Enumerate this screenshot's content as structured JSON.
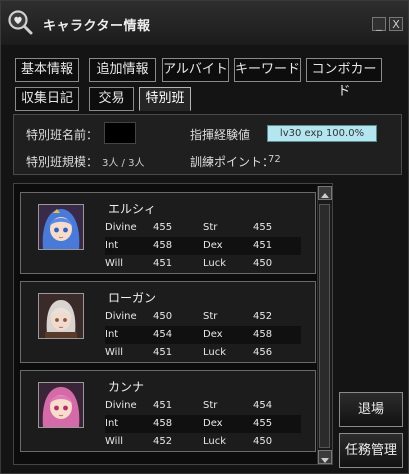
{
  "window": {
    "title": "キャラクター情報",
    "minimize_label": "_",
    "close_label": "X"
  },
  "tabs_row1": [
    "基本情報",
    "追加情報",
    "アルバイト",
    "キーワード",
    "コンボカード"
  ],
  "tabs_row2": [
    "収集日記",
    "交易",
    "特別班"
  ],
  "active_tab": "特別班",
  "squad": {
    "name_label": "特別班名前：",
    "size_label": "特別班規模：",
    "size_value": "3人 / 3人",
    "exp_label": "指揮経験値",
    "exp_value": "lv30 exp 100.0%",
    "exp_progress": 1.0,
    "points_label": "訓練ポイント：",
    "points_value": "72"
  },
  "members": [
    {
      "name": "エルシィ",
      "avatar": "blue-hair-girl-portrait",
      "stats": [
        [
          "Divine",
          "455",
          "Str",
          "455"
        ],
        [
          "Int",
          "458",
          "Dex",
          "451"
        ],
        [
          "Will",
          "451",
          "Luck",
          "450"
        ]
      ]
    },
    {
      "name": "ローガン",
      "avatar": "white-hair-boy-portrait",
      "stats": [
        [
          "Divine",
          "450",
          "Str",
          "452"
        ],
        [
          "Int",
          "454",
          "Dex",
          "458"
        ],
        [
          "Will",
          "451",
          "Luck",
          "456"
        ]
      ]
    },
    {
      "name": "カンナ",
      "avatar": "pink-hair-girl-portrait",
      "stats": [
        [
          "Divine",
          "451",
          "Str",
          "454"
        ],
        [
          "Int",
          "458",
          "Dex",
          "455"
        ],
        [
          "Will",
          "452",
          "Luck",
          "450"
        ]
      ]
    }
  ],
  "buttons": {
    "leave": "退場",
    "mission": "任務管理"
  },
  "colors": {
    "exp_bar": "#b4e6f0",
    "window_bg": "#141414",
    "tab_border": "#8a8a8a"
  }
}
